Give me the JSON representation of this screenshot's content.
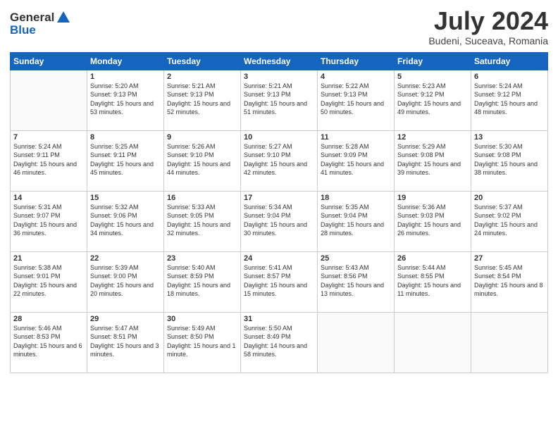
{
  "header": {
    "logo_line1": "General",
    "logo_line2": "Blue",
    "month_year": "July 2024",
    "location": "Budeni, Suceava, Romania"
  },
  "columns": [
    "Sunday",
    "Monday",
    "Tuesday",
    "Wednesday",
    "Thursday",
    "Friday",
    "Saturday"
  ],
  "weeks": [
    [
      {
        "day": "",
        "sunrise": "",
        "sunset": "",
        "daylight": "",
        "empty": true
      },
      {
        "day": "1",
        "sunrise": "Sunrise: 5:20 AM",
        "sunset": "Sunset: 9:13 PM",
        "daylight": "Daylight: 15 hours and 53 minutes."
      },
      {
        "day": "2",
        "sunrise": "Sunrise: 5:21 AM",
        "sunset": "Sunset: 9:13 PM",
        "daylight": "Daylight: 15 hours and 52 minutes."
      },
      {
        "day": "3",
        "sunrise": "Sunrise: 5:21 AM",
        "sunset": "Sunset: 9:13 PM",
        "daylight": "Daylight: 15 hours and 51 minutes."
      },
      {
        "day": "4",
        "sunrise": "Sunrise: 5:22 AM",
        "sunset": "Sunset: 9:13 PM",
        "daylight": "Daylight: 15 hours and 50 minutes."
      },
      {
        "day": "5",
        "sunrise": "Sunrise: 5:23 AM",
        "sunset": "Sunset: 9:12 PM",
        "daylight": "Daylight: 15 hours and 49 minutes."
      },
      {
        "day": "6",
        "sunrise": "Sunrise: 5:24 AM",
        "sunset": "Sunset: 9:12 PM",
        "daylight": "Daylight: 15 hours and 48 minutes."
      }
    ],
    [
      {
        "day": "7",
        "sunrise": "Sunrise: 5:24 AM",
        "sunset": "Sunset: 9:11 PM",
        "daylight": "Daylight: 15 hours and 46 minutes."
      },
      {
        "day": "8",
        "sunrise": "Sunrise: 5:25 AM",
        "sunset": "Sunset: 9:11 PM",
        "daylight": "Daylight: 15 hours and 45 minutes."
      },
      {
        "day": "9",
        "sunrise": "Sunrise: 5:26 AM",
        "sunset": "Sunset: 9:10 PM",
        "daylight": "Daylight: 15 hours and 44 minutes."
      },
      {
        "day": "10",
        "sunrise": "Sunrise: 5:27 AM",
        "sunset": "Sunset: 9:10 PM",
        "daylight": "Daylight: 15 hours and 42 minutes."
      },
      {
        "day": "11",
        "sunrise": "Sunrise: 5:28 AM",
        "sunset": "Sunset: 9:09 PM",
        "daylight": "Daylight: 15 hours and 41 minutes."
      },
      {
        "day": "12",
        "sunrise": "Sunrise: 5:29 AM",
        "sunset": "Sunset: 9:08 PM",
        "daylight": "Daylight: 15 hours and 39 minutes."
      },
      {
        "day": "13",
        "sunrise": "Sunrise: 5:30 AM",
        "sunset": "Sunset: 9:08 PM",
        "daylight": "Daylight: 15 hours and 38 minutes."
      }
    ],
    [
      {
        "day": "14",
        "sunrise": "Sunrise: 5:31 AM",
        "sunset": "Sunset: 9:07 PM",
        "daylight": "Daylight: 15 hours and 36 minutes."
      },
      {
        "day": "15",
        "sunrise": "Sunrise: 5:32 AM",
        "sunset": "Sunset: 9:06 PM",
        "daylight": "Daylight: 15 hours and 34 minutes."
      },
      {
        "day": "16",
        "sunrise": "Sunrise: 5:33 AM",
        "sunset": "Sunset: 9:05 PM",
        "daylight": "Daylight: 15 hours and 32 minutes."
      },
      {
        "day": "17",
        "sunrise": "Sunrise: 5:34 AM",
        "sunset": "Sunset: 9:04 PM",
        "daylight": "Daylight: 15 hours and 30 minutes."
      },
      {
        "day": "18",
        "sunrise": "Sunrise: 5:35 AM",
        "sunset": "Sunset: 9:04 PM",
        "daylight": "Daylight: 15 hours and 28 minutes."
      },
      {
        "day": "19",
        "sunrise": "Sunrise: 5:36 AM",
        "sunset": "Sunset: 9:03 PM",
        "daylight": "Daylight: 15 hours and 26 minutes."
      },
      {
        "day": "20",
        "sunrise": "Sunrise: 5:37 AM",
        "sunset": "Sunset: 9:02 PM",
        "daylight": "Daylight: 15 hours and 24 minutes."
      }
    ],
    [
      {
        "day": "21",
        "sunrise": "Sunrise: 5:38 AM",
        "sunset": "Sunset: 9:01 PM",
        "daylight": "Daylight: 15 hours and 22 minutes."
      },
      {
        "day": "22",
        "sunrise": "Sunrise: 5:39 AM",
        "sunset": "Sunset: 9:00 PM",
        "daylight": "Daylight: 15 hours and 20 minutes."
      },
      {
        "day": "23",
        "sunrise": "Sunrise: 5:40 AM",
        "sunset": "Sunset: 8:59 PM",
        "daylight": "Daylight: 15 hours and 18 minutes."
      },
      {
        "day": "24",
        "sunrise": "Sunrise: 5:41 AM",
        "sunset": "Sunset: 8:57 PM",
        "daylight": "Daylight: 15 hours and 15 minutes."
      },
      {
        "day": "25",
        "sunrise": "Sunrise: 5:43 AM",
        "sunset": "Sunset: 8:56 PM",
        "daylight": "Daylight: 15 hours and 13 minutes."
      },
      {
        "day": "26",
        "sunrise": "Sunrise: 5:44 AM",
        "sunset": "Sunset: 8:55 PM",
        "daylight": "Daylight: 15 hours and 11 minutes."
      },
      {
        "day": "27",
        "sunrise": "Sunrise: 5:45 AM",
        "sunset": "Sunset: 8:54 PM",
        "daylight": "Daylight: 15 hours and 8 minutes."
      }
    ],
    [
      {
        "day": "28",
        "sunrise": "Sunrise: 5:46 AM",
        "sunset": "Sunset: 8:53 PM",
        "daylight": "Daylight: 15 hours and 6 minutes."
      },
      {
        "day": "29",
        "sunrise": "Sunrise: 5:47 AM",
        "sunset": "Sunset: 8:51 PM",
        "daylight": "Daylight: 15 hours and 3 minutes."
      },
      {
        "day": "30",
        "sunrise": "Sunrise: 5:49 AM",
        "sunset": "Sunset: 8:50 PM",
        "daylight": "Daylight: 15 hours and 1 minute."
      },
      {
        "day": "31",
        "sunrise": "Sunrise: 5:50 AM",
        "sunset": "Sunset: 8:49 PM",
        "daylight": "Daylight: 14 hours and 58 minutes."
      },
      {
        "day": "",
        "sunrise": "",
        "sunset": "",
        "daylight": "",
        "empty": true
      },
      {
        "day": "",
        "sunrise": "",
        "sunset": "",
        "daylight": "",
        "empty": true
      },
      {
        "day": "",
        "sunrise": "",
        "sunset": "",
        "daylight": "",
        "empty": true
      }
    ]
  ]
}
